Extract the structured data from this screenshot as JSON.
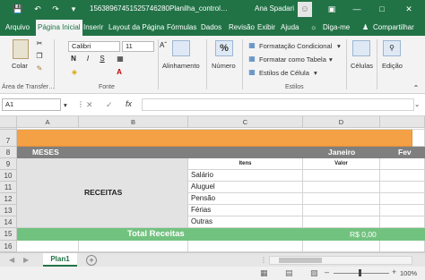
{
  "titlebar": {
    "filename": "15638967451525746280Planilha_control…",
    "user": "Ana Spadari",
    "save_icon": "save-icon",
    "undo_icon": "undo-icon",
    "redo_icon": "redo-icon"
  },
  "menu": {
    "items": [
      "Arquivo",
      "Página Inicial",
      "Inserir",
      "Layout da Página",
      "Fórmulas",
      "Dados",
      "Revisão",
      "Exibir",
      "Ajuda"
    ],
    "tell_me": "Diga-me",
    "share": "Compartilhar",
    "active_index": 1
  },
  "ribbon": {
    "clipboard": {
      "paste": "Colar",
      "title": "Área de Transfer…"
    },
    "font": {
      "name": "Calibri",
      "size": "11",
      "bold": "N",
      "italic": "I",
      "underline": "S",
      "font_color_letter": "A",
      "title": "Fonte"
    },
    "alignment": {
      "label": "Alinhamento"
    },
    "number": {
      "label": "Número",
      "symbol": "%"
    },
    "styles": {
      "conditional": "Formatação Condicional",
      "table": "Formatar como Tabela",
      "cell_styles": "Estilos de Célula",
      "title": "Estilos"
    },
    "cells": {
      "label": "Células"
    },
    "editing": {
      "label": "Edição"
    }
  },
  "formula": {
    "name_box": "A1",
    "fx": "fx",
    "content": ""
  },
  "grid": {
    "columns": [
      "A",
      "B",
      "C",
      "D"
    ],
    "rows": [
      "7",
      "8",
      "9",
      "10",
      "11",
      "12",
      "13",
      "14",
      "15",
      "16"
    ],
    "meses": "MESES",
    "janeiro": "Janeiro",
    "fev": "Fev",
    "itens_header": "Itens",
    "valor_header": "Valor",
    "receitas": "RECEITAS",
    "items": [
      "Salário",
      "Aluguel",
      "Pensão",
      "Férias",
      "Outras"
    ],
    "total_label": "Total Receitas",
    "total_value": "R$ 0,00"
  },
  "sheets": {
    "tabs": [
      "Plan1"
    ],
    "add": "+"
  },
  "status": {
    "zoom": "100%"
  },
  "colors": {
    "excel_green": "#217346",
    "orange": "#f4a045",
    "gray_header": "#7f7f7f",
    "total_green": "#72c27f"
  }
}
